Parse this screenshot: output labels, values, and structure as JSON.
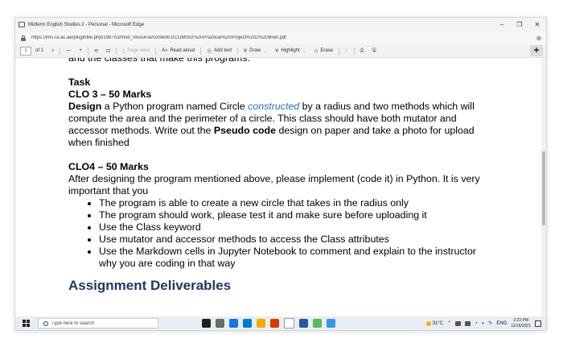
{
  "window": {
    "title": "Midterm English Studies 2 - Personal - Microsoft Edge",
    "controls": {
      "minimize": "–",
      "restore": "❐",
      "close": "✕"
    }
  },
  "address_bar": {
    "url": "https://lms.ra.ac.ae/pluginfile.php/199753/mod_resource/content/1/COM002%20Practical%20Project%202%20Brief.pdf"
  },
  "pdf_toolbar": {
    "page_number": "1",
    "page_total": "of 1",
    "search_icon": "⌕",
    "zoom_out": "—",
    "zoom_in": "+",
    "rotate_icon": "⟲",
    "fit_icon": "⊡",
    "page_view": "Page view",
    "read_aloud": "Read aloud",
    "add_text": "Add text",
    "draw": "Draw",
    "highlight": "Highlight",
    "erase": "Erase",
    "pin_icon": "✚"
  },
  "document": {
    "intro_cut": "and the classes that make this programs.",
    "task_heading": "Task",
    "clo3_heading": "CLO 3 – 50 Marks",
    "clo3_p1_bold": "Design",
    "clo3_p1_a": " a Python program named Circle ",
    "clo3_p1_link": "constructed",
    "clo3_p1_b": " by a radius and two methods which will compute the area and the perimeter of a circle. This class should have both mutator and accessor methods. Write out the ",
    "clo3_p1_bold2": "Pseudo code",
    "clo3_p1_c": " design on paper and take a photo for upload when finished",
    "clo4_heading": "CLO4 – 50 Marks",
    "clo4_p1": "After designing the program mentioned above, please implement (code it) in Python. It is very important that you",
    "bullets": [
      "The program is able to create a new circle that takes in the radius only",
      "The program should work, please test it and make sure before uploading it",
      "Use the Class keyword",
      "Use mutator and accessor methods to access the Class attributes",
      "Use the Markdown cells in Jupyter Notebook to comment and explain to the instructor why you are coding in that way"
    ],
    "deliverables_heading": "Assignment Deliverables"
  },
  "taskbar": {
    "search_placeholder": "Type here to search",
    "temperature": "31°C",
    "language": "ENG",
    "time": "2:23 PM",
    "date": "11/16/2021",
    "app_colors": [
      "#1e1e1e",
      "#6b6b6b",
      "#1a73e8",
      "#0078d4",
      "#f2a900",
      "#d83b01",
      "#ffffff",
      "#2b579a",
      "#5cb85c",
      "#3a96dd"
    ]
  }
}
